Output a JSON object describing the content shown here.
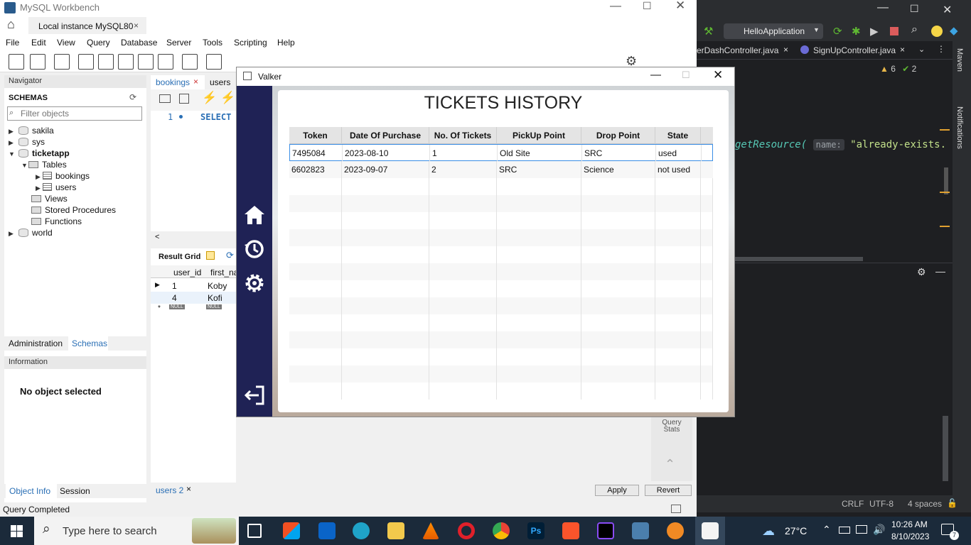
{
  "workbench": {
    "title": "MySQL Workbench",
    "instance_tab": "Local instance MySQL80",
    "menu": [
      "File",
      "Edit",
      "View",
      "Query",
      "Database",
      "Server",
      "Tools",
      "Scripting",
      "Help"
    ],
    "navigator_label": "Navigator",
    "schemas_label": "SCHEMAS",
    "filter_placeholder": "Filter objects",
    "schemas": [
      "sakila",
      "sys",
      "ticketapp",
      "world"
    ],
    "ticketapp_children": {
      "tables": "Tables",
      "table_items": [
        "bookings",
        "users"
      ],
      "views": "Views",
      "procs": "Stored Procedures",
      "functions": "Functions"
    },
    "bottom_tabs": [
      "Administration",
      "Schemas"
    ],
    "information_label": "Information",
    "no_object": "No object selected",
    "info_tabs": [
      "Object Info",
      "Session"
    ],
    "editor_tabs": [
      "bookings",
      "users"
    ],
    "sql_line_no": "1",
    "sql_text": "SELECT",
    "result_grid_label": "Result Grid",
    "result_columns": [
      "user_id",
      "first_na"
    ],
    "result_rows": [
      [
        "1",
        "Koby"
      ],
      [
        "4",
        "Kofi"
      ]
    ],
    "null_label": "NULL",
    "right_panel_label": "Query Stats",
    "users_tab": "users 2",
    "apply_label": "Apply",
    "revert_label": "Revert",
    "status": "Query Completed"
  },
  "intellij": {
    "run_config": "HelloApplication",
    "tabs": [
      "erDashController.java",
      "SignUpController.java"
    ],
    "warnings": "6",
    "checks": "2",
    "code_fn": "getResource(",
    "code_param_hint": "name:",
    "code_string": "\"already-exists.",
    "side_labels": [
      "Maven",
      "Notifications"
    ],
    "status_items": [
      "CRLF",
      "UTF-8",
      "4 spaces"
    ]
  },
  "valker": {
    "window_title": "Valker",
    "heading": "TICKETS HISTORY",
    "columns": [
      "Token",
      "Date Of Purchase",
      "No. Of Tickets",
      "PickUp Point",
      "Drop Point",
      "State"
    ],
    "rows": [
      [
        "7495084",
        "2023-08-10",
        "1",
        "Old Site",
        "SRC",
        "used"
      ],
      [
        "6602823",
        "2023-09-07",
        "2",
        "SRC",
        "Science",
        "not used"
      ]
    ],
    "nav_icons": [
      "home-icon",
      "history-icon",
      "settings-icon",
      "logout-icon"
    ]
  },
  "taskbar": {
    "search_placeholder": "Type here to search",
    "weather": "27°C",
    "time": "10:26 AM",
    "date": "8/10/2023",
    "notification_count": "7"
  }
}
